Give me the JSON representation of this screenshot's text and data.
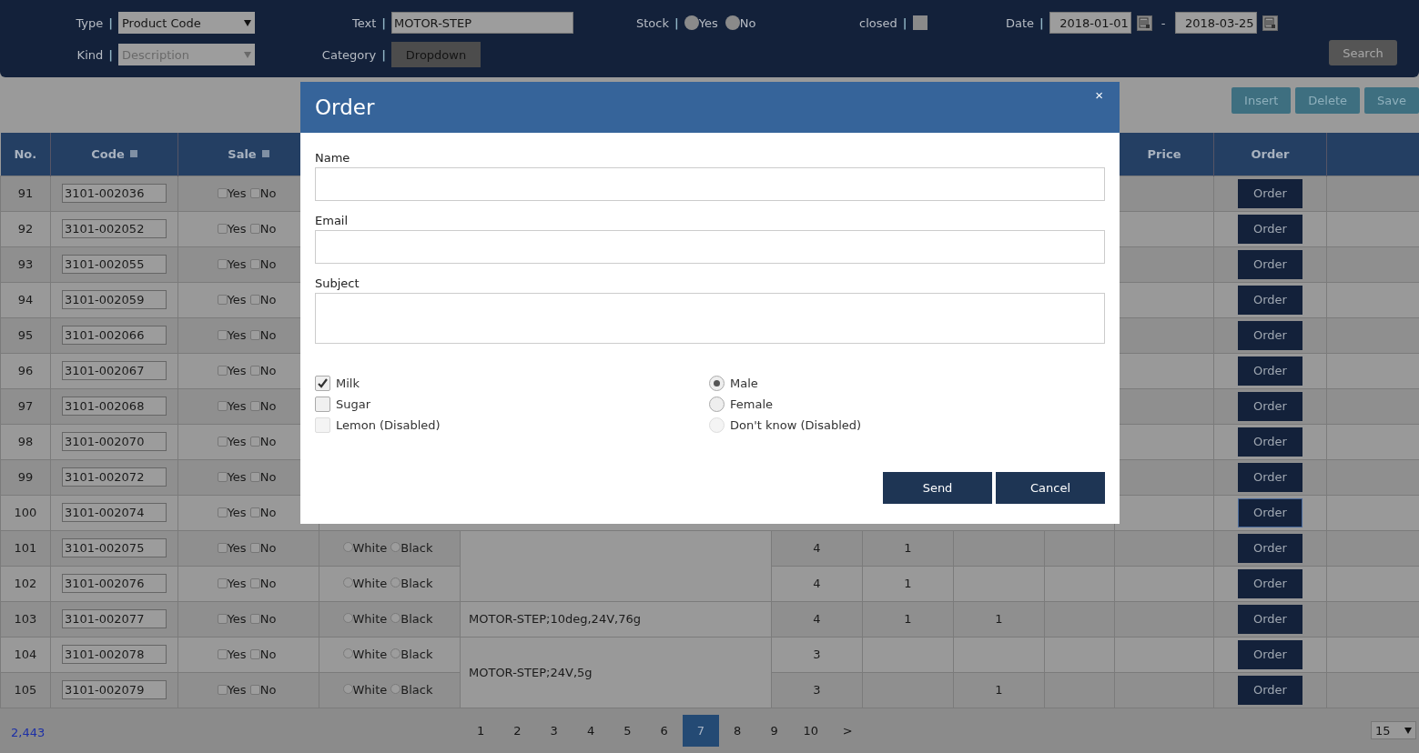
{
  "filters": {
    "row1": [
      {
        "kind": "select",
        "label": "Type",
        "separator": "|",
        "value": "Product Code",
        "disabled": false
      },
      {
        "kind": "text",
        "label": "Text",
        "separator": "|",
        "value": "MOTOR-STEP"
      },
      {
        "kind": "radios",
        "label": "Stock",
        "separator": "|",
        "options": [
          {
            "label": "Yes",
            "selected": false
          },
          {
            "label": "No",
            "selected": false
          }
        ]
      },
      {
        "kind": "checkbox",
        "label": "closed",
        "separator": "|",
        "checked": false
      },
      {
        "kind": "daterange",
        "label": "Date",
        "separator": "|",
        "from": "2018-01-01",
        "dash": "-",
        "to": "2018-03-25"
      }
    ],
    "row2": [
      {
        "kind": "select",
        "label": "Kind",
        "separator": "|",
        "value": "Description",
        "disabled": true
      },
      {
        "kind": "button",
        "label": "Category",
        "separator": "|",
        "value": "Dropdown"
      }
    ],
    "search_button": "Search"
  },
  "actions": [
    "Insert",
    "Delete",
    "Save"
  ],
  "table": {
    "columns": [
      {
        "label": "No.",
        "sortable": false
      },
      {
        "label": "Code",
        "sortable": true
      },
      {
        "label": "Sale",
        "sortable": true
      },
      {
        "label": "Price",
        "sortable": false
      },
      {
        "label": "Order",
        "sortable": false
      }
    ],
    "rows": [
      {
        "no": "91",
        "code": "3101-002036",
        "sale": [
          {
            "label": "Yes",
            "checked": false
          },
          {
            "label": "No",
            "checked": false
          }
        ],
        "order": {
          "label": "Order",
          "focused": false
        }
      },
      {
        "no": "92",
        "code": "3101-002052",
        "sale": [
          {
            "label": "Yes",
            "checked": false
          },
          {
            "label": "No",
            "checked": false
          }
        ],
        "order": {
          "label": "Order",
          "focused": false
        }
      },
      {
        "no": "93",
        "code": "3101-002055",
        "sale": [
          {
            "label": "Yes",
            "checked": false
          },
          {
            "label": "No",
            "checked": false
          }
        ],
        "order": {
          "label": "Order",
          "focused": false
        }
      },
      {
        "no": "94",
        "code": "3101-002059",
        "sale": [
          {
            "label": "Yes",
            "checked": false
          },
          {
            "label": "No",
            "checked": false
          }
        ],
        "order": {
          "label": "Order",
          "focused": false
        }
      },
      {
        "no": "95",
        "code": "3101-002066",
        "sale": [
          {
            "label": "Yes",
            "checked": false
          },
          {
            "label": "No",
            "checked": false
          }
        ],
        "order": {
          "label": "Order",
          "focused": false
        }
      },
      {
        "no": "96",
        "code": "3101-002067",
        "sale": [
          {
            "label": "Yes",
            "checked": false
          },
          {
            "label": "No",
            "checked": false
          }
        ],
        "order": {
          "label": "Order",
          "focused": false
        }
      },
      {
        "no": "97",
        "code": "3101-002068",
        "sale": [
          {
            "label": "Yes",
            "checked": false
          },
          {
            "label": "No",
            "checked": false
          }
        ],
        "order": {
          "label": "Order",
          "focused": false
        }
      },
      {
        "no": "98",
        "code": "3101-002070",
        "sale": [
          {
            "label": "Yes",
            "checked": false
          },
          {
            "label": "No",
            "checked": false
          }
        ],
        "order": {
          "label": "Order",
          "focused": false
        }
      },
      {
        "no": "99",
        "code": "3101-002072",
        "sale": [
          {
            "label": "Yes",
            "checked": false
          },
          {
            "label": "No",
            "checked": false
          }
        ],
        "order": {
          "label": "Order",
          "focused": false
        }
      },
      {
        "no": "100",
        "code": "3101-002074",
        "sale": [
          {
            "label": "Yes",
            "checked": false
          },
          {
            "label": "No",
            "checked": false
          }
        ],
        "order": {
          "label": "Order",
          "focused": true
        }
      },
      {
        "no": "101",
        "code": "3101-002075",
        "sale": [
          {
            "label": "Yes",
            "checked": false
          },
          {
            "label": "No",
            "checked": false
          }
        ],
        "color": [
          {
            "label": "White",
            "selected": false
          },
          {
            "label": "Black",
            "selected": false
          }
        ],
        "description": {
          "merged_with_next": true
        },
        "column_6": "4",
        "column_7": "1",
        "order": {
          "label": "Order",
          "focused": false
        }
      },
      {
        "no": "102",
        "code": "3101-002076",
        "sale": [
          {
            "label": "Yes",
            "checked": false
          },
          {
            "label": "No",
            "checked": false
          }
        ],
        "color": [
          {
            "label": "White",
            "selected": false
          },
          {
            "label": "Black",
            "selected": false
          }
        ],
        "column_6": "4",
        "column_7": "1",
        "order": {
          "label": "Order",
          "focused": false
        }
      },
      {
        "no": "103",
        "code": "3101-002077",
        "sale": [
          {
            "label": "Yes",
            "checked": false
          },
          {
            "label": "No",
            "checked": false
          }
        ],
        "color": [
          {
            "label": "White",
            "selected": false
          },
          {
            "label": "Black",
            "selected": false
          }
        ],
        "description": {
          "text": "MOTOR-STEP;10deg,24V,76g",
          "merged_with_next": false
        },
        "column_6": "4",
        "column_7": "1",
        "column_8": "1",
        "order": {
          "label": "Order",
          "focused": false
        }
      },
      {
        "no": "104",
        "code": "3101-002078",
        "sale": [
          {
            "label": "Yes",
            "checked": false
          },
          {
            "label": "No",
            "checked": false
          }
        ],
        "color": [
          {
            "label": "White",
            "selected": false
          },
          {
            "label": "Black",
            "selected": false
          }
        ],
        "description": {
          "text": "MOTOR-STEP;24V,5g",
          "merged_with_next": true
        },
        "column_6": "3",
        "order": {
          "label": "Order",
          "focused": false
        }
      },
      {
        "no": "105",
        "code": "3101-002079",
        "sale": [
          {
            "label": "Yes",
            "checked": false
          },
          {
            "label": "No",
            "checked": false
          }
        ],
        "color": [
          {
            "label": "White",
            "selected": false
          },
          {
            "label": "Black",
            "selected": false
          }
        ],
        "column_6": "3",
        "column_8": "1",
        "order": {
          "label": "Order",
          "focused": false
        }
      }
    ]
  },
  "pagination": {
    "total": "2,443",
    "pages": [
      {
        "label": "1",
        "selected": false
      },
      {
        "label": "2",
        "selected": false
      },
      {
        "label": "3",
        "selected": false
      },
      {
        "label": "4",
        "selected": false
      },
      {
        "label": "5",
        "selected": false
      },
      {
        "label": "6",
        "selected": false
      },
      {
        "label": "7",
        "selected": true
      },
      {
        "label": "8",
        "selected": false
      },
      {
        "label": "9",
        "selected": false
      },
      {
        "label": "10",
        "selected": false
      }
    ],
    "next": ">",
    "page_size": "15"
  },
  "modal": {
    "title": "Order",
    "close": "×",
    "fields": [
      {
        "label": "Name",
        "kind": "input"
      },
      {
        "label": "Email",
        "kind": "input"
      },
      {
        "label": "Subject",
        "kind": "textarea"
      }
    ],
    "checkboxes": [
      {
        "label": "Milk",
        "checked": true,
        "disabled": false
      },
      {
        "label": "Sugar",
        "checked": false,
        "disabled": false
      },
      {
        "label": "Lemon (Disabled)",
        "checked": false,
        "disabled": true
      }
    ],
    "radios": [
      {
        "label": "Male",
        "selected": true,
        "disabled": false
      },
      {
        "label": "Female",
        "selected": false,
        "disabled": false
      },
      {
        "label": "Don't know (Disabled)",
        "selected": false,
        "disabled": true
      }
    ],
    "buttons": [
      "Send",
      "Cancel"
    ]
  }
}
